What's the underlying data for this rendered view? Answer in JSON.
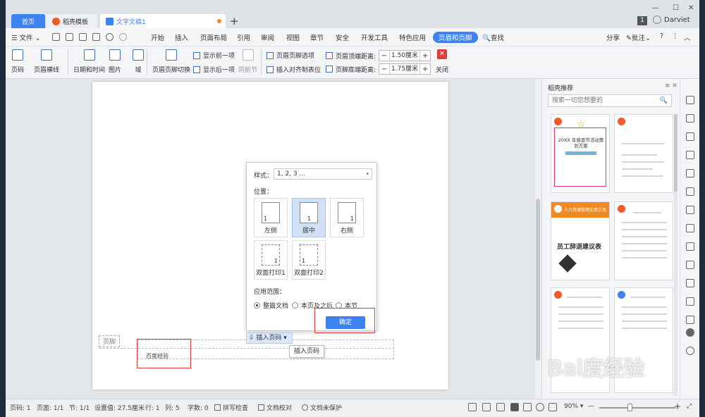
{
  "tabs": {
    "home": "首页",
    "template": "稻壳模板",
    "doc": "文字文稿1",
    "new_tab": "+"
  },
  "window": {
    "page_badge": "1",
    "user": "Darviet",
    "min": "—",
    "max": "☐",
    "close": "✕"
  },
  "menu": {
    "file": "文件",
    "items": [
      "开始",
      "插入",
      "页面布局",
      "引用",
      "审阅",
      "视图",
      "章节",
      "安全",
      "开发工具",
      "特色应用",
      "页眉和页脚"
    ],
    "find": "查找",
    "share": "分享",
    "annotate": "批注",
    "help": "?"
  },
  "ribbon": {
    "page_number": "页码",
    "header_line": "页眉横线",
    "datetime": "日期和时间",
    "picture": "图片",
    "field": "域",
    "switch": "页眉页脚切换",
    "show_prev": "显示前一项",
    "show_next": "显示后一项",
    "same_as_prev": "同前节",
    "options": "页眉页脚选项",
    "insert_align_tab": "插入对齐制表位",
    "header_top_label": "页眉顶端距离:",
    "header_top_value": "1.50厘米",
    "footer_bottom_label": "页脚底端距离:",
    "footer_bottom_value": "1.75厘米",
    "close": "关闭"
  },
  "doc": {
    "footer_tag": "页脚",
    "footer_text": "百度经验"
  },
  "popup": {
    "style_label": "样式：",
    "style_value": "1, 2, 3 ...",
    "position_label": "位置：",
    "positions": [
      {
        "label": "左侧",
        "num": "1"
      },
      {
        "label": "居中",
        "num": "1"
      },
      {
        "label": "右侧",
        "num": "1"
      },
      {
        "label": "双面打印1",
        "num": "1"
      },
      {
        "label": "双面打印2",
        "num": "1"
      }
    ],
    "range_label": "应用范围：",
    "ranges": [
      "整篇文档",
      "本页及之后",
      "本节"
    ],
    "ok": "确定",
    "insert_button": "插入页码",
    "tooltip": "插入页码"
  },
  "panel": {
    "title": "稻壳推荐",
    "search_placeholder": "搜索一切您想要的",
    "card1_title": "20XX 年感恩节活动策划方案",
    "card3_banner": "人力资源管理实用工具",
    "card3_title": "员工辞退建议表"
  },
  "status": {
    "page_num": "页码: 1",
    "pages": "页面: 1/1",
    "section": "节: 1/1",
    "setting": "设置值: 27.5厘米",
    "row": "行: 1",
    "col": "列: 5",
    "words": "字数: 0",
    "spell": "拼写检查",
    "proof": "文档校对",
    "protect": "文档未保护",
    "zoom": "90%",
    "zoom_out": "—",
    "zoom_in": "+"
  },
  "watermark": "Bai度经验"
}
